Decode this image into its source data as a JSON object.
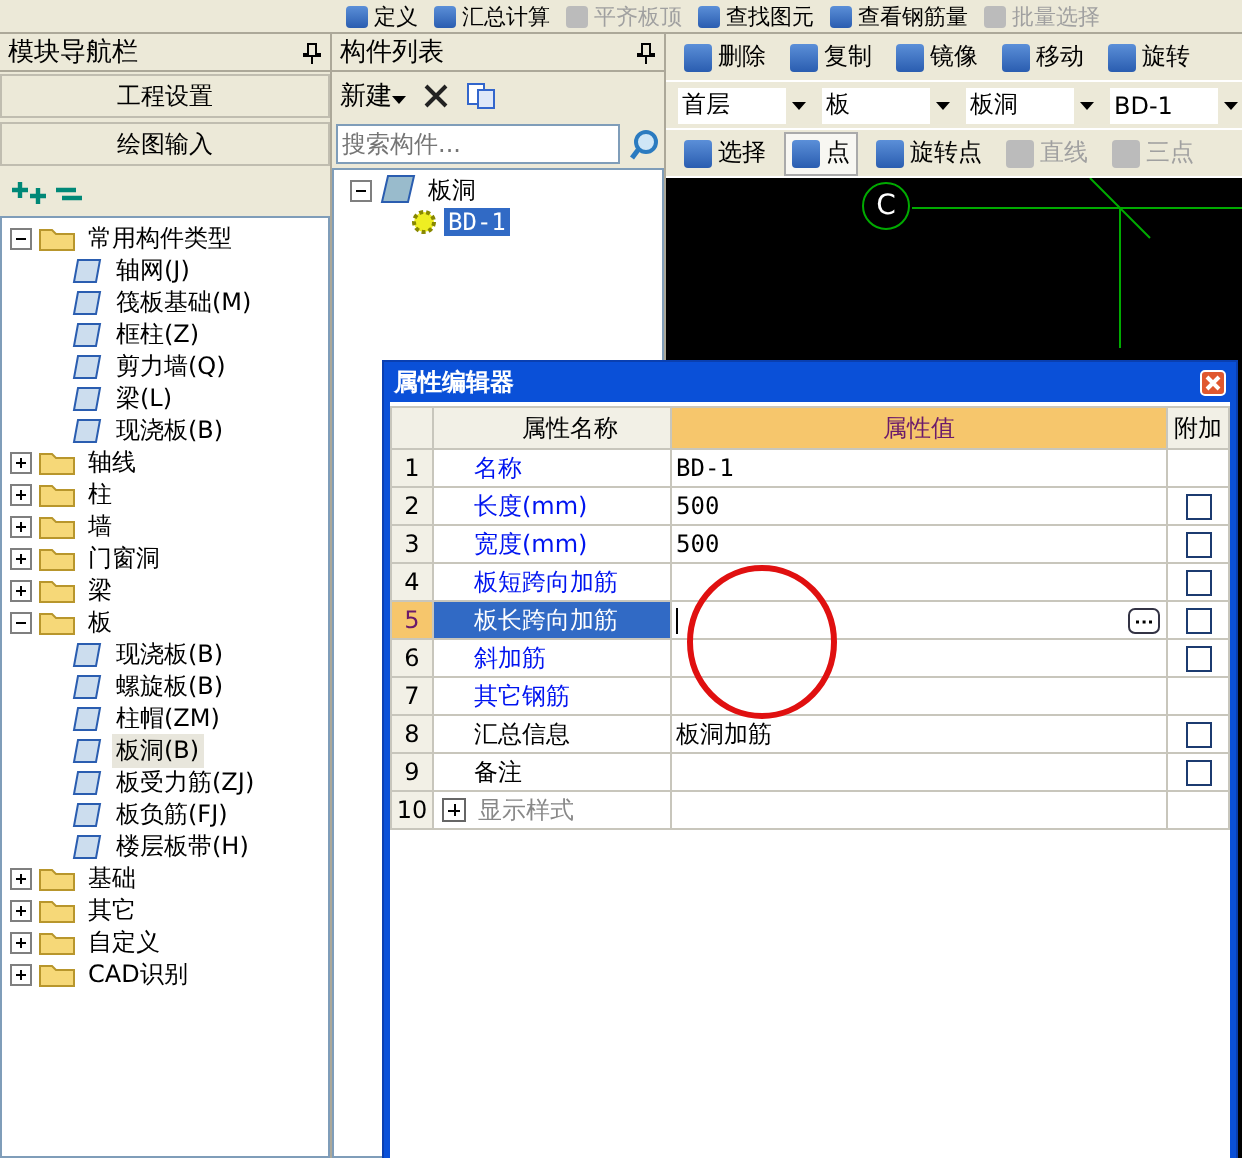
{
  "toolbar_top": [
    {
      "label": "定义",
      "disabled": false
    },
    {
      "label": "汇总计算",
      "disabled": false
    },
    {
      "label": "平齐板顶",
      "disabled": true
    },
    {
      "label": "查找图元",
      "disabled": false
    },
    {
      "label": "查看钢筋量",
      "disabled": false
    },
    {
      "label": "批量选择",
      "disabled": true
    }
  ],
  "nav_panel": {
    "title": "模块导航栏",
    "buttons": [
      "工程设置",
      "绘图输入"
    ],
    "tree": [
      {
        "label": "常用构件类型",
        "expanded": true,
        "children": [
          {
            "label": "轴网(J)",
            "selected": false
          },
          {
            "label": "筏板基础(M)",
            "selected": false
          },
          {
            "label": "框柱(Z)",
            "selected": false
          },
          {
            "label": "剪力墙(Q)",
            "selected": false
          },
          {
            "label": "梁(L)",
            "selected": false
          },
          {
            "label": "现浇板(B)",
            "selected": false
          }
        ]
      },
      {
        "label": "轴线",
        "expanded": false
      },
      {
        "label": "柱",
        "expanded": false
      },
      {
        "label": "墙",
        "expanded": false
      },
      {
        "label": "门窗洞",
        "expanded": false
      },
      {
        "label": "梁",
        "expanded": false
      },
      {
        "label": "板",
        "expanded": true,
        "children": [
          {
            "label": "现浇板(B)",
            "selected": false
          },
          {
            "label": "螺旋板(B)",
            "selected": false
          },
          {
            "label": "柱帽(ZM)",
            "selected": false
          },
          {
            "label": "板洞(B)",
            "selected": true
          },
          {
            "label": "板受力筋(ZJ)",
            "selected": false
          },
          {
            "label": "板负筋(FJ)",
            "selected": false
          },
          {
            "label": "楼层板带(H)",
            "selected": false
          }
        ]
      },
      {
        "label": "基础",
        "expanded": false
      },
      {
        "label": "其它",
        "expanded": false
      },
      {
        "label": "自定义",
        "expanded": false
      },
      {
        "label": "CAD识别",
        "expanded": false
      }
    ]
  },
  "component_list": {
    "title": "构件列表",
    "new_button": "新建",
    "search": {
      "placeholder": "搜索构件..."
    },
    "tree": [
      {
        "label": "板洞",
        "expanded": true,
        "children": [
          {
            "label": "BD-1",
            "selected": true
          }
        ]
      }
    ]
  },
  "edit_toolbar": [
    "删除",
    "复制",
    "镜像",
    "移动",
    "旋转"
  ],
  "selectors": [
    "首层",
    "板",
    "板洞",
    "BD-1"
  ],
  "draw_toolbar": [
    {
      "label": "选择",
      "selected": false,
      "disabled": false
    },
    {
      "label": "点",
      "selected": true,
      "disabled": false
    },
    {
      "label": "旋转点",
      "selected": false,
      "disabled": false
    },
    {
      "label": "直线",
      "selected": false,
      "disabled": true
    },
    {
      "label": "三点",
      "selected": false,
      "disabled": true
    }
  ],
  "canvas": {
    "axis_label": "C"
  },
  "property_editor": {
    "title": "属性编辑器",
    "columns": [
      "属性名称",
      "属性值",
      "附加"
    ],
    "rows": [
      {
        "index": "1",
        "name": "名称",
        "value": "BD-1",
        "kind": "link",
        "selected": false
      },
      {
        "index": "2",
        "name": "长度(mm)",
        "value": "500",
        "kind": "link",
        "selected": false,
        "checked": false
      },
      {
        "index": "3",
        "name": "宽度(mm)",
        "value": "500",
        "kind": "link",
        "selected": false,
        "checked": false
      },
      {
        "index": "4",
        "name": "板短跨向加筋",
        "value": "",
        "kind": "link",
        "selected": false,
        "checked": false
      },
      {
        "index": "5",
        "name": "板长跨向加筋",
        "value": "",
        "kind": "link",
        "selected": true,
        "checked": false
      },
      {
        "index": "6",
        "name": "斜加筋",
        "value": "",
        "kind": "link",
        "selected": false,
        "checked": false
      },
      {
        "index": "7",
        "name": "其它钢筋",
        "value": "",
        "kind": "link",
        "selected": false
      },
      {
        "index": "8",
        "name": "汇总信息",
        "value": "板洞加筋",
        "kind": "plain",
        "selected": false,
        "checked": false
      },
      {
        "index": "9",
        "name": "备注",
        "value": "",
        "kind": "plain",
        "selected": false,
        "checked": false
      },
      {
        "index": "10",
        "name": "显示样式",
        "value": "",
        "kind": "group",
        "selected": false
      }
    ]
  }
}
